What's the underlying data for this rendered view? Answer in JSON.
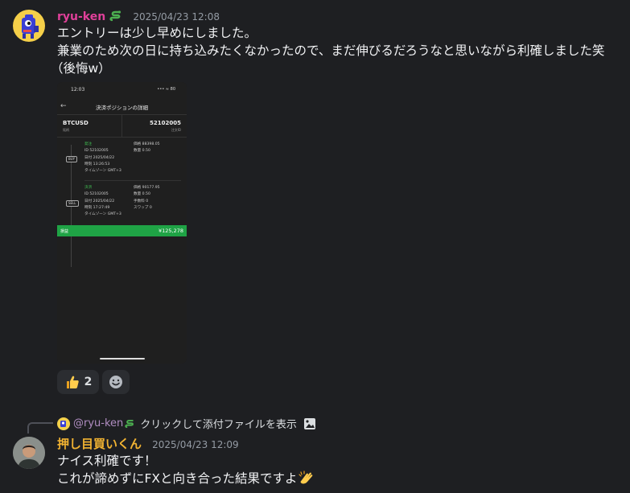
{
  "messages": [
    {
      "username": "ryu-ken",
      "username_emoji": "snake",
      "username_color": "#e0409a",
      "timestamp": "2025/04/23 12:08",
      "lines": [
        "エントリーは少し早めにしました。",
        "兼業のため次の日に持ち込みたくなかったので、まだ伸びるだろうなと思いながら利確しました笑",
        "（後悔w）"
      ],
      "attachment": {
        "status_time": "12:03",
        "status_icons": "••• ≈ 80",
        "title": "決済ポジションの詳細",
        "symbol": "BTCUSD",
        "symbol_sub": "銘柄",
        "order_id": "52102005",
        "order_id_sub": "注文ID",
        "entry": {
          "badge": "BUY",
          "label": "発注",
          "id_line": "ID 52102005",
          "date_line": "日付 2025/04/22",
          "time_line": "時刻 13:26:53",
          "tz_line": "タイムゾーン GMT+3",
          "price_line": "価格 88398.05",
          "qty_line": "数量 0.50"
        },
        "exit": {
          "badge": "SELL",
          "label": "決済",
          "id_line": "ID 52102005",
          "date_line": "日付 2025/04/22",
          "time_line": "時刻 17:27:49",
          "tz_line": "タイムゾーン GMT+3",
          "price_line": "価格 90177.95",
          "qty_line": "数量 0.50",
          "fee_line": "手数料 0",
          "swap_line": "スワップ 0"
        },
        "profit_label": "損益",
        "profit_value": "¥125,278"
      },
      "reactions": [
        {
          "emoji": "thumbs-up",
          "count": "2"
        },
        {
          "emoji": "add-reaction",
          "count": ""
        }
      ]
    },
    {
      "reply_to": {
        "username": "@ryu-ken",
        "text": "クリックして添付ファイルを表示"
      },
      "username": "押し目買いくん",
      "username_color": "#f0b232",
      "timestamp": "2025/04/23 12:09",
      "lines": [
        "ナイス利確です！",
        "これが諦めずにFXと向き合った結果ですよ"
      ],
      "trailing_emoji": "clapping-hands"
    }
  ]
}
